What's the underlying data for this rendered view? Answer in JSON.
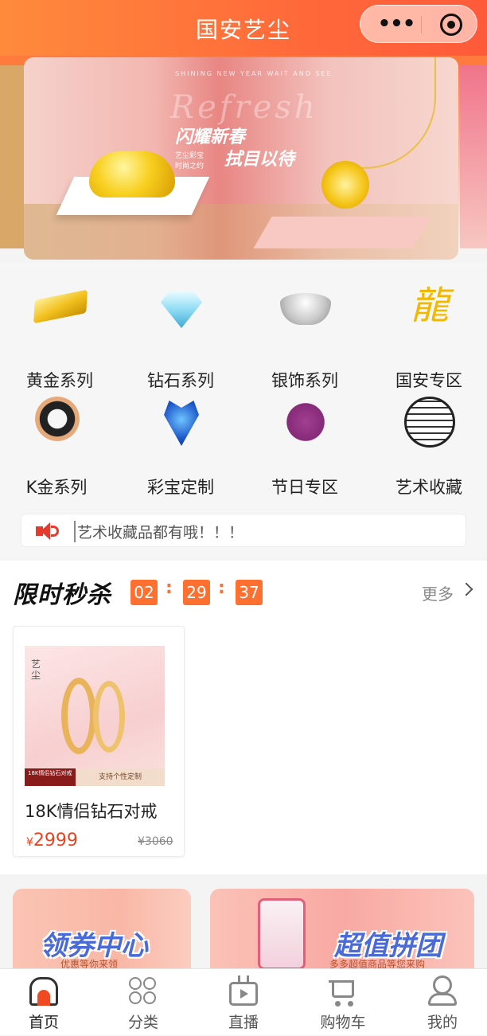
{
  "header": {
    "title": "国安艺尘"
  },
  "banner": {
    "subtitle": "SHINING NEW YEAR WAIT AND SEE",
    "overlay_word": "Refresh",
    "headline_1": "闪耀新春",
    "headline_2": "拭目以待",
    "tagline": "艺尘彩宝时尚之约"
  },
  "categories": [
    {
      "label": "黄金系列",
      "icon": "gold-bar-icon"
    },
    {
      "label": "钻石系列",
      "icon": "diamond-icon"
    },
    {
      "label": "银饰系列",
      "icon": "silver-ingot-icon"
    },
    {
      "label": "国安专区",
      "icon": "dragon-logo-icon"
    },
    {
      "label": "K金系列",
      "icon": "ring-icon"
    },
    {
      "label": "彩宝定制",
      "icon": "heart-pendant-icon"
    },
    {
      "label": "节日专区",
      "icon": "couple-icon"
    },
    {
      "label": "艺术收藏",
      "icon": "lattice-icon"
    }
  ],
  "notice": {
    "text": "艺术收藏品都有哦！！！",
    "icon": "speaker-icon"
  },
  "flash_sale": {
    "title": "限时秒杀",
    "countdown": {
      "hours": "02",
      "minutes": "29",
      "seconds": "37",
      "sep": ":"
    },
    "more_label": "更多",
    "product": {
      "name": "18K情侣钻石对戒",
      "price": "2999",
      "currency": "¥",
      "original_price": "¥3060",
      "brand_mark": "艺尘",
      "tag_left": "18K情侣钻石对戒",
      "tag_right": "支持个性定制"
    }
  },
  "promos": [
    {
      "title": "领券中心",
      "subtitle": "优惠等你来领"
    },
    {
      "title": "超值拼团",
      "subtitle": "多多超值商品等您来购"
    }
  ],
  "tabbar": [
    {
      "label": "首页",
      "icon": "home-icon",
      "active": true
    },
    {
      "label": "分类",
      "icon": "category-grid-icon",
      "active": false
    },
    {
      "label": "直播",
      "icon": "live-tv-icon",
      "active": false
    },
    {
      "label": "购物车",
      "icon": "cart-icon",
      "active": false
    },
    {
      "label": "我的",
      "icon": "user-icon",
      "active": false
    }
  ],
  "colors": {
    "accent": "#ff6a3a",
    "price": "#f0411c",
    "timer": "#ff6f2f"
  }
}
